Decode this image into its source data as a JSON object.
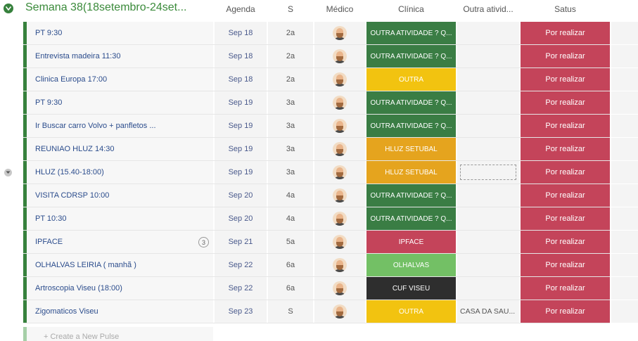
{
  "group": {
    "title": "Semana 38(18setembro-24set...",
    "color": "#37813d"
  },
  "columns": {
    "agenda": "Agenda",
    "s": "S",
    "medico": "Médico",
    "clinica": "Clínica",
    "outra": "Outra ativid...",
    "satus": "Satus"
  },
  "colors": {
    "outra_atividade": "#3a7d44",
    "outra": "#f2c310",
    "hluz": "#e5a41e",
    "ipface": "#c4445a",
    "olhalvas": "#73c065",
    "cuf": "#2e2e2e",
    "status": "#c4445a"
  },
  "rows": [
    {
      "name": "PT 9:30",
      "agenda": "Sep 18",
      "s": "2a",
      "clinica": "OUTRA ATIVIDADE ? Q...",
      "clinica_color": "#3a7d44",
      "outra": "",
      "status": "Por realizar",
      "count": ""
    },
    {
      "name": "Entrevista madeira 11:30",
      "agenda": "Sep 18",
      "s": "2a",
      "clinica": "OUTRA ATIVIDADE ? Q...",
      "clinica_color": "#3a7d44",
      "outra": "",
      "status": "Por realizar",
      "count": ""
    },
    {
      "name": "Clinica Europa 17:00",
      "agenda": "Sep 18",
      "s": "2a",
      "clinica": "OUTRA",
      "clinica_color": "#f2c310",
      "outra": "",
      "status": "Por realizar",
      "count": ""
    },
    {
      "name": "PT 9:30",
      "agenda": "Sep 19",
      "s": "3a",
      "clinica": "OUTRA ATIVIDADE ? Q...",
      "clinica_color": "#3a7d44",
      "outra": "",
      "status": "Por realizar",
      "count": ""
    },
    {
      "name": "Ir Buscar carro Volvo + panfletos ...",
      "agenda": "Sep 19",
      "s": "3a",
      "clinica": "OUTRA ATIVIDADE ? Q...",
      "clinica_color": "#3a7d44",
      "outra": "",
      "status": "Por realizar",
      "count": ""
    },
    {
      "name": "REUNIAO HLUZ 14:30",
      "agenda": "Sep 19",
      "s": "3a",
      "clinica": "HLUZ SETUBAL",
      "clinica_color": "#e5a41e",
      "outra": "",
      "status": "Por realizar",
      "count": ""
    },
    {
      "name": "HLUZ (15.40-18:00)",
      "agenda": "Sep 19",
      "s": "3a",
      "clinica": "HLUZ SETUBAL",
      "clinica_color": "#e5a41e",
      "outra": "",
      "status": "Por realizar",
      "count": "",
      "hover": true
    },
    {
      "name": "VISITA CDRSP 10:00",
      "agenda": "Sep 20",
      "s": "4a",
      "clinica": "OUTRA ATIVIDADE ? Q...",
      "clinica_color": "#3a7d44",
      "outra": "",
      "status": "Por realizar",
      "count": ""
    },
    {
      "name": "PT 10:30",
      "agenda": "Sep 20",
      "s": "4a",
      "clinica": "OUTRA ATIVIDADE ? Q...",
      "clinica_color": "#3a7d44",
      "outra": "",
      "status": "Por realizar",
      "count": ""
    },
    {
      "name": "IPFACE",
      "agenda": "Sep 21",
      "s": "5a",
      "clinica": "IPFACE",
      "clinica_color": "#c4445a",
      "outra": "",
      "status": "Por realizar",
      "count": "3"
    },
    {
      "name": "OLHALVAS LEIRIA ( manhã )",
      "agenda": "Sep 22",
      "s": "6a",
      "clinica": "OLHALVAS",
      "clinica_color": "#73c065",
      "outra": "",
      "status": "Por realizar",
      "count": ""
    },
    {
      "name": "Artroscopia Viseu (18:00)",
      "agenda": "Sep 22",
      "s": "6a",
      "clinica": "CUF VISEU",
      "clinica_color": "#2e2e2e",
      "outra": "",
      "status": "Por realizar",
      "count": ""
    },
    {
      "name": "Zigomaticos Viseu",
      "agenda": "Sep 23",
      "s": "S",
      "clinica": "OUTRA",
      "clinica_color": "#f2c310",
      "outra": "CASA DA SAU...",
      "status": "Por realizar",
      "count": ""
    }
  ],
  "footer": {
    "add_placeholder": "+ Create a New Pulse"
  }
}
